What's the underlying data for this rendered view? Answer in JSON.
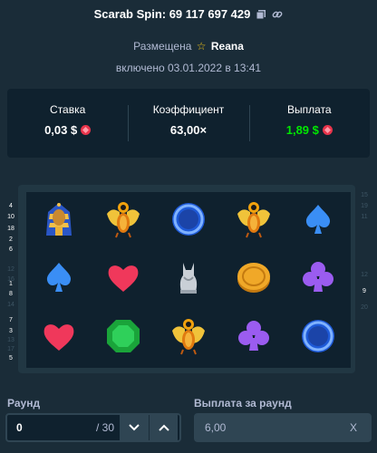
{
  "header": {
    "title": "Scarab Spin: 69 117 697 429",
    "posted_by_label": "Размещена",
    "username": "Reana",
    "included_on": "включено 03.01.2022 в 13:41"
  },
  "stats": {
    "bet_label": "Ставка",
    "bet_value": "0,03 $",
    "multiplier_label": "Коэффициент",
    "multiplier_value": "63,00×",
    "payout_label": "Выплата",
    "payout_value": "1,89 $",
    "accent_color": "#00e701"
  },
  "board": {
    "rows": [
      [
        "pharaoh",
        "scarab",
        "blue-ring",
        "scarab",
        "blue-spade"
      ],
      [
        "blue-spade",
        "red-heart",
        "cat-statue",
        "gold-coin",
        "purple-club"
      ],
      [
        "red-heart",
        "green-gem",
        "scarab",
        "purple-club",
        "blue-ring"
      ]
    ],
    "paylines_left": [
      {
        "n": "4",
        "dim": false
      },
      {
        "n": "10",
        "dim": false
      },
      {
        "n": "18",
        "dim": false
      },
      {
        "n": "2",
        "dim": false
      },
      {
        "n": "6",
        "dim": false
      },
      {
        "n": "12",
        "dim": true
      },
      {
        "n": "16",
        "dim": true
      },
      {
        "n": "1",
        "dim": false
      },
      {
        "n": "8",
        "dim": false
      },
      {
        "n": "14",
        "dim": true
      },
      {
        "n": "7",
        "dim": false
      },
      {
        "n": "3",
        "dim": false
      },
      {
        "n": "13",
        "dim": true
      },
      {
        "n": "17",
        "dim": true
      },
      {
        "n": "5",
        "dim": false
      }
    ],
    "paylines_right": [
      {
        "n": "15",
        "dim": true
      },
      {
        "n": "19",
        "dim": true
      },
      {
        "n": "11",
        "dim": true
      },
      {
        "n": "12",
        "dim": true
      },
      {
        "n": "9",
        "dim": false
      },
      {
        "n": "20",
        "dim": true
      }
    ]
  },
  "controls": {
    "round_label": "Раунд",
    "round_value": "0",
    "round_total": "/ 30",
    "round_payout_label": "Выплата за раунд",
    "round_payout_value": "6,00",
    "round_payout_suffix": "X"
  }
}
